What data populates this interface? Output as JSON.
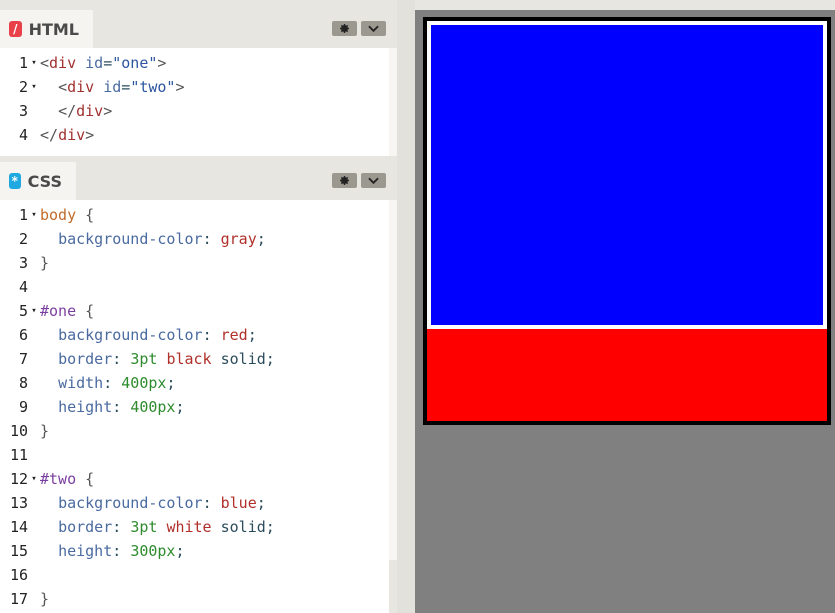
{
  "html_panel": {
    "title": "HTML",
    "badge": "/",
    "badge_color": "#e8414a",
    "settings_icon": "gear-icon",
    "collapse_icon": "chevron-down-icon",
    "lines": [
      {
        "n": "1",
        "fold": "▾",
        "parts": [
          [
            "c-bracket",
            "<"
          ],
          [
            "c-tag",
            "div"
          ],
          [
            "c-plain",
            " "
          ],
          [
            "c-attr",
            "id"
          ],
          [
            "c-plain",
            "="
          ],
          [
            "c-str",
            "\"one\""
          ],
          [
            "c-bracket",
            ">"
          ]
        ]
      },
      {
        "n": "2",
        "fold": "▾",
        "parts": [
          [
            "c-plain",
            "  "
          ],
          [
            "c-bracket",
            "<"
          ],
          [
            "c-tag",
            "div"
          ],
          [
            "c-plain",
            " "
          ],
          [
            "c-attr",
            "id"
          ],
          [
            "c-plain",
            "="
          ],
          [
            "c-str",
            "\"two\""
          ],
          [
            "c-bracket",
            ">"
          ]
        ]
      },
      {
        "n": "3",
        "fold": "",
        "parts": [
          [
            "c-plain",
            "  "
          ],
          [
            "c-bracket",
            "</"
          ],
          [
            "c-tag",
            "div"
          ],
          [
            "c-bracket",
            ">"
          ]
        ]
      },
      {
        "n": "4",
        "fold": "",
        "parts": [
          [
            "c-bracket",
            "</"
          ],
          [
            "c-tag",
            "div"
          ],
          [
            "c-bracket",
            ">"
          ]
        ]
      }
    ]
  },
  "css_panel": {
    "title": "CSS",
    "badge": "*",
    "badge_color": "#1fa9e0",
    "settings_icon": "gear-icon",
    "collapse_icon": "chevron-down-icon",
    "lines": [
      {
        "n": "1",
        "fold": "▾",
        "parts": [
          [
            "c-sel",
            "body"
          ],
          [
            "c-plain",
            " "
          ],
          [
            "c-bracket",
            "{"
          ]
        ]
      },
      {
        "n": "2",
        "fold": "",
        "parts": [
          [
            "c-plain",
            "  "
          ],
          [
            "c-prop",
            "background-color"
          ],
          [
            "c-plain",
            ": "
          ],
          [
            "c-kw",
            "gray"
          ],
          [
            "c-plain",
            ";"
          ]
        ]
      },
      {
        "n": "3",
        "fold": "",
        "parts": [
          [
            "c-bracket",
            "}"
          ]
        ]
      },
      {
        "n": "4",
        "fold": "",
        "parts": []
      },
      {
        "n": "5",
        "fold": "▾",
        "parts": [
          [
            "c-id",
            "#one"
          ],
          [
            "c-plain",
            " "
          ],
          [
            "c-bracket",
            "{"
          ]
        ]
      },
      {
        "n": "6",
        "fold": "",
        "parts": [
          [
            "c-plain",
            "  "
          ],
          [
            "c-prop",
            "background-color"
          ],
          [
            "c-plain",
            ": "
          ],
          [
            "c-kw",
            "red"
          ],
          [
            "c-plain",
            ";"
          ]
        ]
      },
      {
        "n": "7",
        "fold": "",
        "parts": [
          [
            "c-plain",
            "  "
          ],
          [
            "c-prop",
            "border"
          ],
          [
            "c-plain",
            ": "
          ],
          [
            "c-num",
            "3pt"
          ],
          [
            "c-plain",
            " "
          ],
          [
            "c-kw",
            "black"
          ],
          [
            "c-plain",
            " solid;"
          ]
        ]
      },
      {
        "n": "8",
        "fold": "",
        "parts": [
          [
            "c-plain",
            "  "
          ],
          [
            "c-prop",
            "width"
          ],
          [
            "c-plain",
            ": "
          ],
          [
            "c-num",
            "400px"
          ],
          [
            "c-plain",
            ";"
          ]
        ]
      },
      {
        "n": "9",
        "fold": "",
        "parts": [
          [
            "c-plain",
            "  "
          ],
          [
            "c-prop",
            "height"
          ],
          [
            "c-plain",
            ": "
          ],
          [
            "c-num",
            "400px"
          ],
          [
            "c-plain",
            ";"
          ]
        ]
      },
      {
        "n": "10",
        "fold": "",
        "parts": [
          [
            "c-bracket",
            "}"
          ]
        ]
      },
      {
        "n": "11",
        "fold": "",
        "parts": []
      },
      {
        "n": "12",
        "fold": "▾",
        "parts": [
          [
            "c-id",
            "#two"
          ],
          [
            "c-plain",
            " "
          ],
          [
            "c-bracket",
            "{"
          ]
        ]
      },
      {
        "n": "13",
        "fold": "",
        "parts": [
          [
            "c-plain",
            "  "
          ],
          [
            "c-prop",
            "background-color"
          ],
          [
            "c-plain",
            ": "
          ],
          [
            "c-kw",
            "blue"
          ],
          [
            "c-plain",
            ";"
          ]
        ]
      },
      {
        "n": "14",
        "fold": "",
        "parts": [
          [
            "c-plain",
            "  "
          ],
          [
            "c-prop",
            "border"
          ],
          [
            "c-plain",
            ": "
          ],
          [
            "c-num",
            "3pt"
          ],
          [
            "c-plain",
            " "
          ],
          [
            "c-kw",
            "white"
          ],
          [
            "c-plain",
            " solid;"
          ]
        ]
      },
      {
        "n": "15",
        "fold": "",
        "parts": [
          [
            "c-plain",
            "  "
          ],
          [
            "c-prop",
            "height"
          ],
          [
            "c-plain",
            ": "
          ],
          [
            "c-num",
            "300px"
          ],
          [
            "c-plain",
            ";"
          ]
        ]
      },
      {
        "n": "16",
        "fold": "",
        "parts": []
      },
      {
        "n": "17",
        "fold": "",
        "parts": [
          [
            "c-bracket",
            "}"
          ]
        ]
      }
    ]
  },
  "preview": {
    "body_color": "#808080",
    "outer_color": "#ff0000",
    "outer_border": "#000000",
    "inner_color": "#0000ff",
    "inner_border": "#ffffff"
  }
}
